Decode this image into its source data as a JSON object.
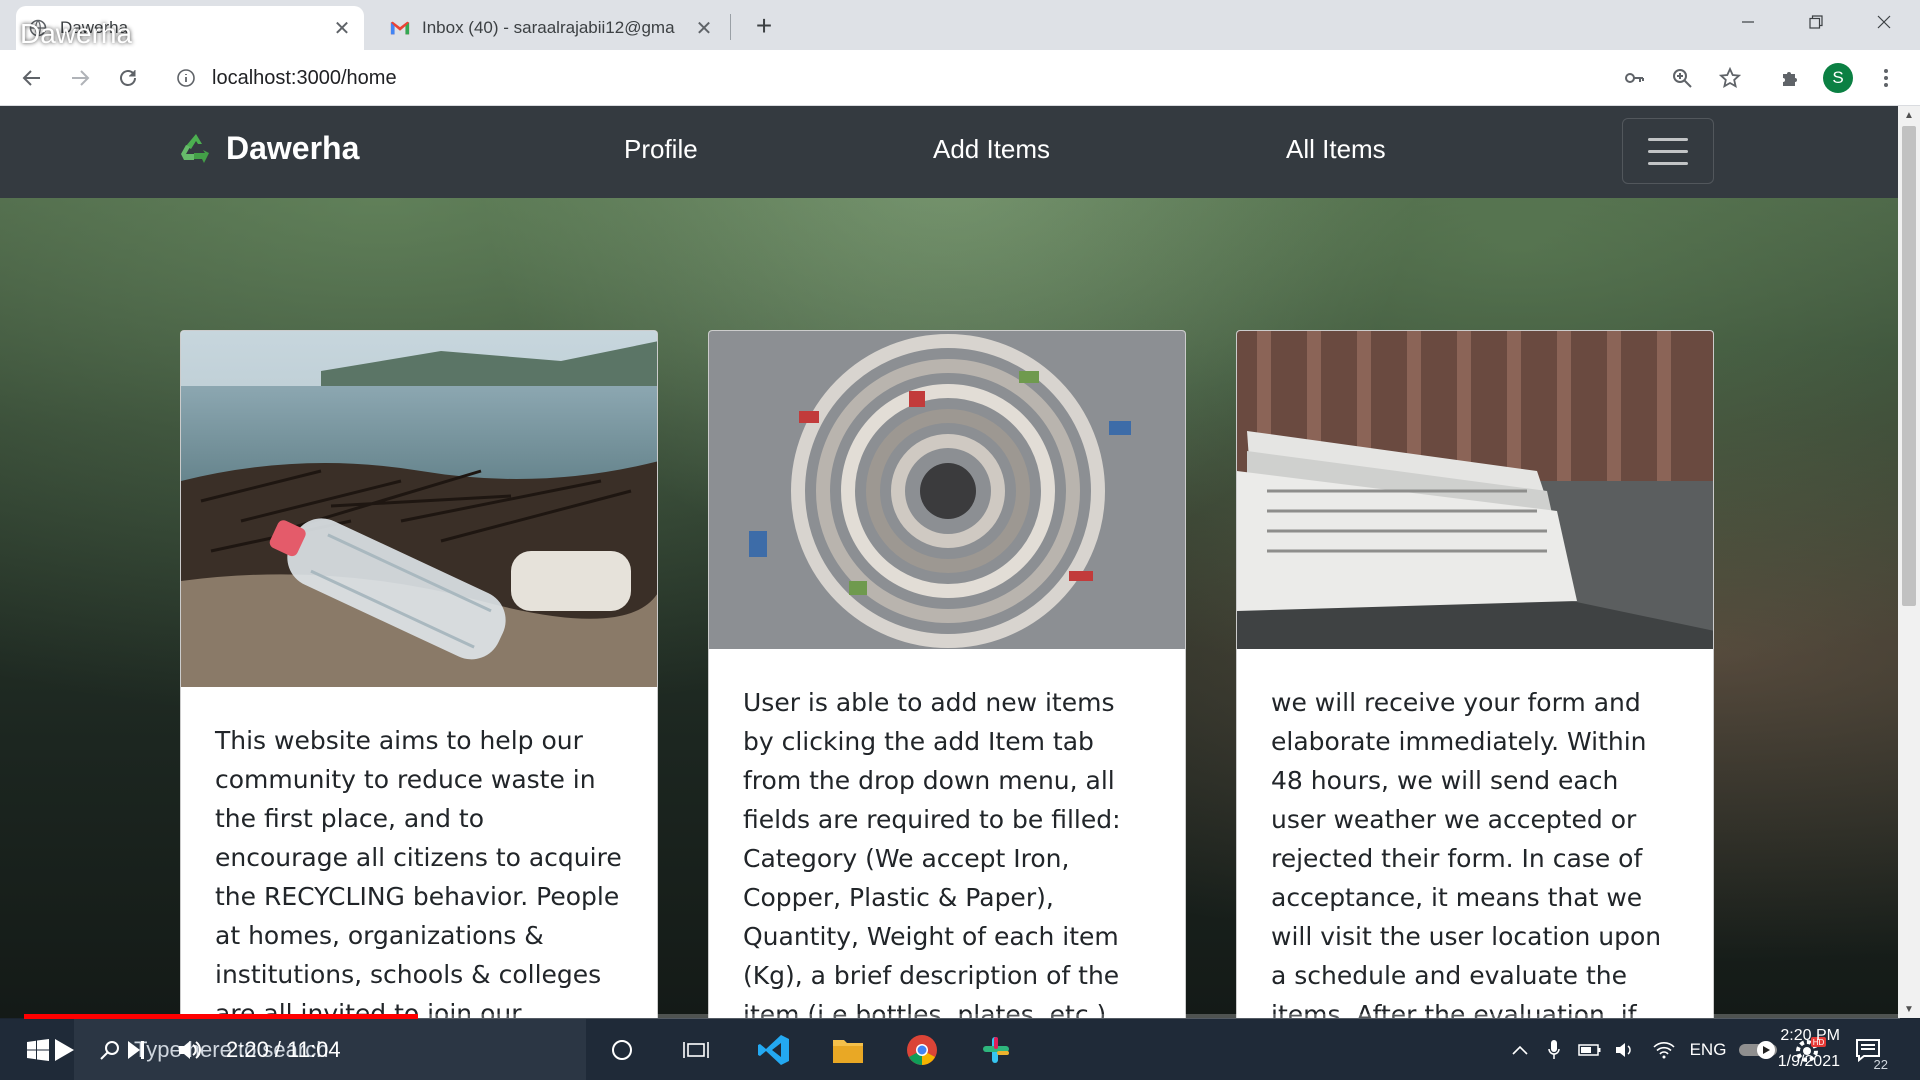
{
  "video_title": "Dawerha",
  "browser": {
    "tabs": [
      {
        "title": "Dawerha",
        "close": "✕"
      },
      {
        "title": "Inbox (40) - saraalrajabii12@gma",
        "close": "✕"
      }
    ],
    "new_tab": "+",
    "url": "localhost:3000/home",
    "profile_initial": "S"
  },
  "navbar": {
    "brand": "Dawerha",
    "links": [
      "Profile",
      "Add Items",
      "All Items"
    ]
  },
  "cards": [
    {
      "text": "This website aims to help our community to reduce waste in the first place, and to encourage all citizens to acquire the RECYCLING behavior. People at homes, organizations & institutions, schools & colleges are all invited to join our website"
    },
    {
      "text": "User is able to add new items by clicking the add Item tab from the drop down menu, all fields are required to be filled: Category (We accept Iron, Copper, Plastic & Paper), Quantity, Weight of each item (Kg), a brief description of the item (i.e bottles, plates, etc.)"
    },
    {
      "text": "we will receive your form and elaborate immediately. Within 48 hours, we will send each user weather we accepted or rejected their form. In case of acceptance, it means that we will visit the user location upon a schedule and evaluate the items. After the evaluation, if items"
    }
  ],
  "player": {
    "timecode": "2:20 / 11:04",
    "progress": 0.21
  },
  "taskbar": {
    "search_placeholder": "Type here to search",
    "language": "ENG",
    "time": "2:20 PM",
    "date": "1/9/2021",
    "notifications": "22"
  },
  "colors": {
    "navbar": "#343a40",
    "progress": "#ff0000",
    "brand_logo": "#4caf50"
  }
}
